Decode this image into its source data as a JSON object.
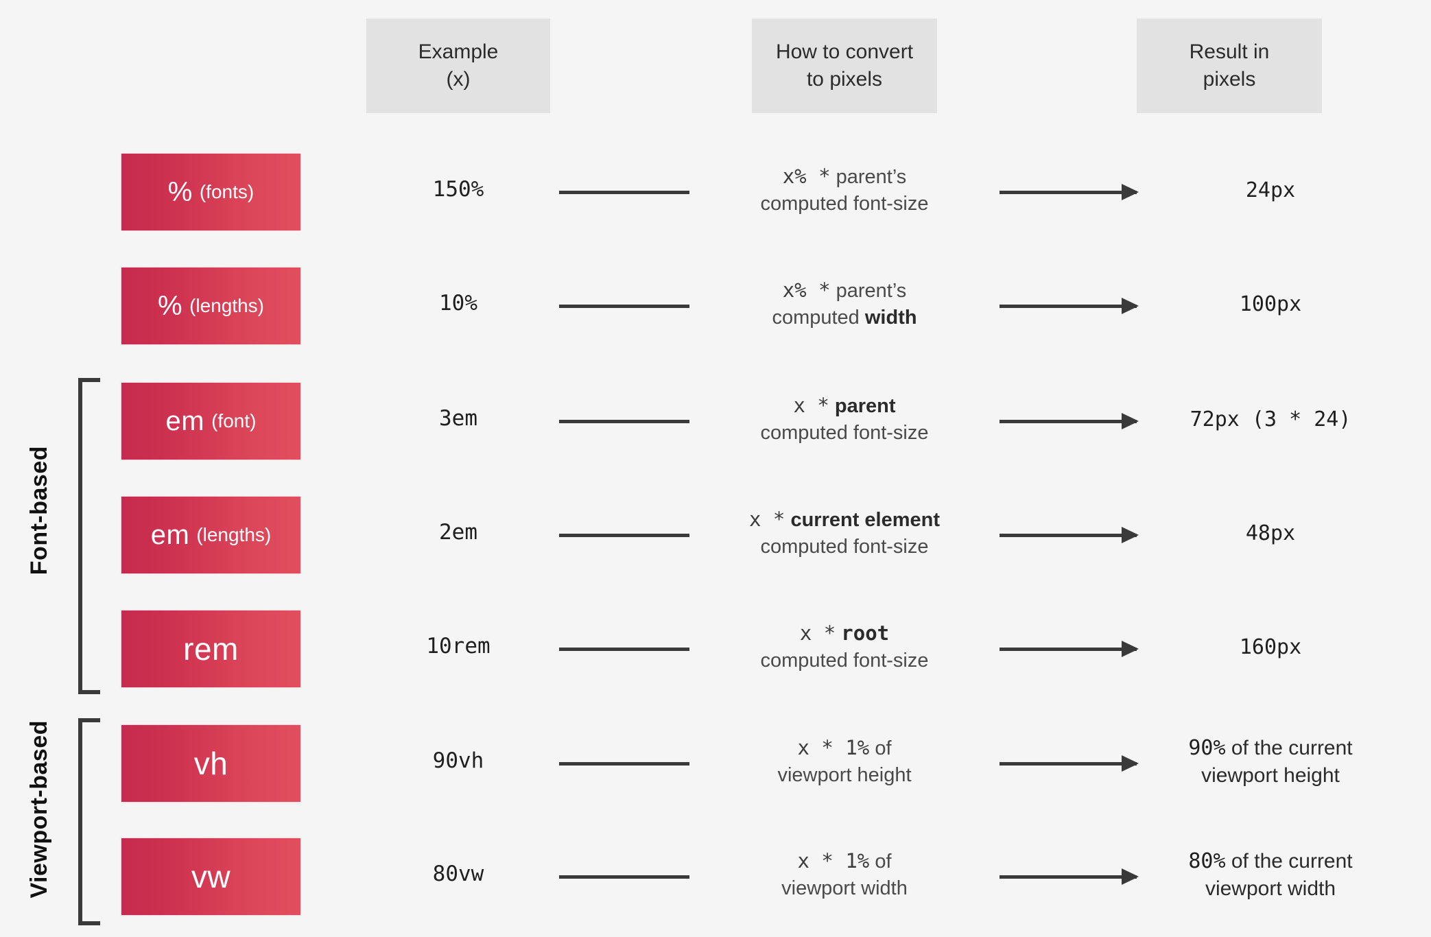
{
  "background_color": "#f5f5f5",
  "accent_gradient": {
    "from": "#c62a4e",
    "to": "#e14f5e"
  },
  "header": {
    "cells": [
      {
        "line1": "Example",
        "line2": "(x)"
      },
      {
        "line1": "How to convert",
        "line2": "to pixels"
      },
      {
        "line1": "Result in",
        "line2": "pixels"
      }
    ]
  },
  "groups": [
    {
      "label": "Font-based"
    },
    {
      "label": "Viewport-based"
    }
  ],
  "rows": [
    {
      "unit_main": "%",
      "unit_sub": "(fonts)",
      "example": "150%",
      "convert_line1_mono": "x%  *",
      "convert_line1_sans": "parent’s",
      "convert_line1_bold": "",
      "convert_line2_sans": "computed font-size",
      "convert_line2_bold": "",
      "result_mono": "24px",
      "result_sans": ""
    },
    {
      "unit_main": "%",
      "unit_sub": "(lengths)",
      "example": "10%",
      "convert_line1_mono": "x%  *",
      "convert_line1_sans": "parent’s",
      "convert_line1_bold": "",
      "convert_line2_sans": "computed ",
      "convert_line2_bold": "width",
      "result_mono": "100px",
      "result_sans": ""
    },
    {
      "unit_main": "em",
      "unit_sub": "(font)",
      "example": "3em",
      "convert_line1_mono": "x  *",
      "convert_line1_sans": "",
      "convert_line1_bold": "parent",
      "convert_line2_sans": "computed font-size",
      "convert_line2_bold": "",
      "result_mono": "72px  (3 * 24)",
      "result_sans": ""
    },
    {
      "unit_main": "em",
      "unit_sub": "(lengths)",
      "example": "2em",
      "convert_line1_mono": "x  *",
      "convert_line1_sans": "",
      "convert_line1_bold": "current element",
      "convert_line2_sans": "computed font-size",
      "convert_line2_bold": "",
      "result_mono": "48px",
      "result_sans": ""
    },
    {
      "unit_main": "rem",
      "unit_sub": "",
      "example": "10rem",
      "convert_line1_mono": "x  *",
      "convert_line1_sans": "",
      "convert_line1_monob": "root",
      "convert_line1_bold": "",
      "convert_line2_sans": "computed font-size",
      "convert_line2_bold": "",
      "result_mono": "160px",
      "result_sans": ""
    },
    {
      "unit_main": "vh",
      "unit_sub": "",
      "example": "90vh",
      "convert_line1_mono": "x  *  1%",
      "convert_line1_sans": "of",
      "convert_line1_bold": "",
      "convert_line2_sans": "viewport height",
      "convert_line2_bold": "",
      "result_mono": "90%",
      "result_sans": "of the current viewport height"
    },
    {
      "unit_main": "vw",
      "unit_sub": "",
      "example": "80vw",
      "convert_line1_mono": "x  *  1%",
      "convert_line1_sans": "of",
      "convert_line1_bold": "",
      "convert_line2_sans": "viewport width",
      "convert_line2_bold": "",
      "result_mono": "80%",
      "result_sans": "of the current viewport width"
    }
  ]
}
